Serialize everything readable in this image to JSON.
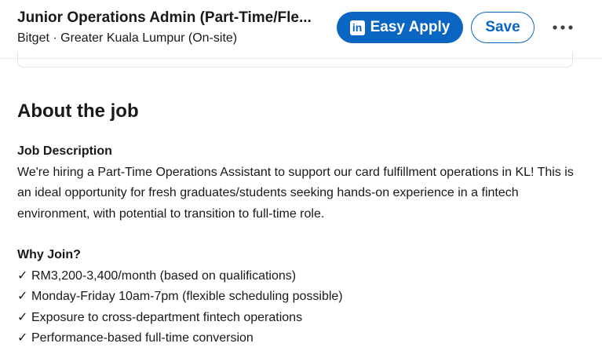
{
  "header": {
    "job_title": "Junior Operations Admin (Part-Time/Fle...",
    "company_location": "Bitget · Greater Kuala Lumpur (On-site)",
    "easy_apply_label": "Easy Apply",
    "easy_apply_icon": "linkedin-icon",
    "save_label": "Save",
    "more_icon": "more-horizontal-icon",
    "accent_color": "#0a66c2"
  },
  "about": {
    "heading": "About the job",
    "job_description_heading": "Job Description",
    "job_description_text": "We're hiring a Part-Time Operations Assistant to support our card fulfillment operations in KL! This is an ideal opportunity for fresh graduates/students seeking hands-on experience in a fintech environment, with potential to transition to full-time role.",
    "why_join_heading": "Why Join?",
    "check_glyph": "✓",
    "benefits": [
      "RM3,200-3,400/month (based on qualifications)",
      "Monday-Friday 10am-7pm (flexible scheduling possible)",
      "Exposure to cross-department fintech operations",
      "Performance-based full-time conversion"
    ]
  }
}
